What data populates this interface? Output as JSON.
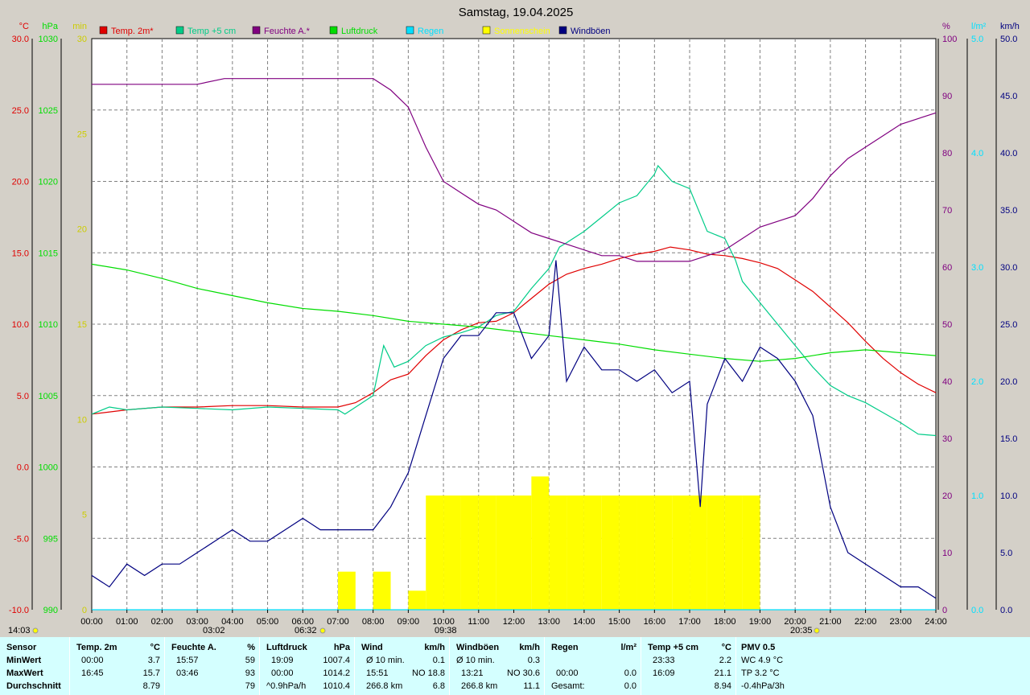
{
  "title": "Samstag, 19.04.2025",
  "colors": {
    "temp2m": "#e00000",
    "temp5cm": "#00cc88",
    "humidity": "#800080",
    "pressure": "#00dd00",
    "rain": "#00e0ff",
    "sun": "#ffff00",
    "gust": "#000080",
    "stats_bg": "#d4ffff",
    "plot_bg": "#ffffff",
    "frame_bg": "#d4d0c8"
  },
  "axis_units": {
    "temp": "°C",
    "pressure": "hPa",
    "sun": "min",
    "humidity": "%",
    "rain": "l/m²",
    "wind": "km/h"
  },
  "legend": [
    {
      "label": "Temp. 2m*",
      "color": "#e00000"
    },
    {
      "label": "Temp +5 cm",
      "color": "#00cc88"
    },
    {
      "label": "Feuchte A.*",
      "color": "#800080"
    },
    {
      "label": "Luftdruck",
      "color": "#00dd00"
    },
    {
      "label": "Regen",
      "color": "#00e0ff"
    },
    {
      "label": "Sonnenschein",
      "color": "#ffff00"
    },
    {
      "label": "Windböen",
      "color": "#000080"
    }
  ],
  "sun_markers": {
    "sunrise": "06:32",
    "sunset": "20:35",
    "day_length": "14:03"
  },
  "time_markers": [
    "03:02",
    "09:38"
  ],
  "chart_data": {
    "type": "line",
    "title": "Samstag, 19.04.2025",
    "x_ticks": [
      "00:00",
      "01:00",
      "02:00",
      "03:00",
      "04:00",
      "05:00",
      "06:00",
      "07:00",
      "08:00",
      "09:00",
      "10:00",
      "11:00",
      "12:00",
      "13:00",
      "14:00",
      "15:00",
      "16:00",
      "17:00",
      "18:00",
      "19:00",
      "20:00",
      "21:00",
      "22:00",
      "23:00",
      "24:00"
    ],
    "axes": {
      "temp": {
        "unit": "°C",
        "ylim": [
          -10,
          30
        ],
        "ticks": [
          "30.0",
          "25.0",
          "20.0",
          "15.0",
          "10.0",
          "5.0",
          "0.0",
          "-5.0",
          "-10.0"
        ]
      },
      "pressure": {
        "unit": "hPa",
        "ylim": [
          990,
          1030
        ],
        "ticks": [
          "1030",
          "1025",
          "1020",
          "1015",
          "1010",
          "1005",
          "1000",
          "995",
          "990"
        ]
      },
      "sun": {
        "unit": "min",
        "ylim": [
          0,
          30
        ],
        "ticks": [
          "30",
          "25",
          "20",
          "15",
          "10",
          "5",
          "0"
        ]
      },
      "humidity": {
        "unit": "%",
        "ylim": [
          0,
          100
        ],
        "ticks": [
          "100",
          "90",
          "80",
          "70",
          "60",
          "50",
          "40",
          "30",
          "20",
          "10",
          "0"
        ]
      },
      "rain": {
        "unit": "l/m²",
        "ylim": [
          0,
          5
        ],
        "ticks": [
          "5.0",
          "4.0",
          "3.0",
          "2.0",
          "1.0",
          "0.0"
        ]
      },
      "wind": {
        "unit": "km/h",
        "ylim": [
          0,
          50
        ],
        "ticks": [
          "50.0",
          "45.0",
          "40.0",
          "35.0",
          "30.0",
          "25.0",
          "20.0",
          "15.0",
          "10.0",
          "5.0",
          "0.0"
        ]
      }
    },
    "grid": true,
    "legend_position": "top",
    "series": [
      {
        "name": "Temp. 2m*",
        "axis": "temp",
        "x": [
          0,
          1,
          2,
          3,
          4,
          5,
          6,
          7,
          7.5,
          8,
          8.5,
          9,
          9.5,
          10,
          10.5,
          11,
          11.5,
          12,
          12.5,
          13,
          13.5,
          14,
          14.5,
          15,
          15.5,
          16,
          16.45,
          17,
          17.5,
          18,
          18.5,
          19,
          19.5,
          20,
          20.5,
          21,
          21.5,
          22,
          22.5,
          23,
          23.5,
          24
        ],
        "y": [
          3.7,
          4.0,
          4.2,
          4.2,
          4.3,
          4.3,
          4.2,
          4.2,
          4.5,
          5.2,
          6.1,
          6.5,
          7.8,
          8.9,
          9.6,
          10.1,
          10.2,
          10.8,
          11.8,
          12.8,
          13.5,
          13.9,
          14.2,
          14.6,
          14.9,
          15.1,
          15.4,
          15.2,
          14.9,
          14.8,
          14.6,
          14.3,
          13.9,
          13.1,
          12.3,
          11.2,
          10.1,
          8.8,
          7.6,
          6.6,
          5.8,
          5.2
        ]
      },
      {
        "name": "Temp +5 cm",
        "axis": "temp",
        "x": [
          0,
          0.5,
          1,
          2,
          3,
          4,
          5,
          6,
          7,
          7.2,
          8,
          8.3,
          8.6,
          9,
          9.5,
          10,
          10.5,
          11,
          11.5,
          12,
          12.5,
          13,
          13.3,
          13.5,
          14,
          14.5,
          15,
          15.5,
          16,
          16.1,
          16.5,
          17,
          17.5,
          18,
          18.3,
          18.5,
          19,
          19.5,
          20,
          20.5,
          21,
          21.5,
          22,
          22.5,
          23,
          23.5,
          24
        ],
        "y": [
          3.7,
          4.2,
          4.0,
          4.2,
          4.1,
          4.0,
          4.2,
          4.1,
          4.0,
          3.7,
          5.0,
          8.5,
          7.0,
          7.4,
          8.5,
          9.1,
          9.4,
          9.8,
          10.6,
          10.9,
          12.5,
          13.9,
          15.4,
          15.7,
          16.5,
          17.5,
          18.5,
          19.0,
          20.5,
          21.1,
          20.0,
          19.5,
          16.5,
          16.0,
          14.5,
          13.0,
          11.5,
          10.0,
          8.5,
          7.0,
          5.7,
          5.0,
          4.5,
          3.8,
          3.1,
          2.3,
          2.2
        ]
      },
      {
        "name": "Feuchte A.*",
        "axis": "humidity",
        "x": [
          0,
          1,
          2,
          3,
          3.77,
          4,
          5,
          6,
          7,
          8,
          8.5,
          9,
          9.5,
          10,
          10.5,
          11,
          11.5,
          12,
          12.5,
          13,
          13.5,
          14,
          14.5,
          15,
          15.5,
          16,
          16.5,
          17,
          17.5,
          18,
          18.5,
          19,
          19.5,
          20,
          20.5,
          21,
          21.5,
          22,
          22.5,
          23,
          23.5,
          24
        ],
        "y": [
          92,
          92,
          92,
          92,
          93,
          93,
          93,
          93,
          93,
          93,
          91,
          88,
          81,
          75,
          73,
          71,
          70,
          68,
          66,
          65,
          64,
          63,
          62,
          62,
          61,
          61,
          61,
          61,
          62,
          63,
          65,
          67,
          68,
          69,
          72,
          76,
          79,
          81,
          83,
          85,
          86,
          87
        ]
      },
      {
        "name": "Luftdruck",
        "axis": "pressure",
        "x": [
          0,
          1,
          2,
          3,
          4,
          5,
          6,
          7,
          8,
          9,
          10,
          11,
          12,
          13,
          14,
          15,
          16,
          17,
          18,
          19,
          20,
          21,
          22,
          23,
          24
        ],
        "y": [
          1014.2,
          1013.8,
          1013.2,
          1012.5,
          1012.0,
          1011.5,
          1011.1,
          1010.9,
          1010.6,
          1010.2,
          1010.0,
          1009.8,
          1009.5,
          1009.2,
          1008.9,
          1008.6,
          1008.2,
          1007.9,
          1007.6,
          1007.4,
          1007.6,
          1008.0,
          1008.2,
          1008.0,
          1007.8
        ]
      },
      {
        "name": "Windböen",
        "axis": "wind",
        "x": [
          0,
          0.5,
          1,
          1.5,
          2,
          2.5,
          3,
          3.5,
          4,
          4.5,
          5,
          5.5,
          6,
          6.5,
          7,
          7.5,
          8,
          8.5,
          9,
          9.5,
          10,
          10.5,
          11,
          11.5,
          12,
          12.5,
          13,
          13.2,
          13.5,
          14,
          14.5,
          15,
          15.5,
          16,
          16.5,
          17,
          17.3,
          17.5,
          18,
          18.5,
          19,
          19.5,
          20,
          20.5,
          21,
          21.5,
          22,
          22.5,
          23,
          23.5,
          24
        ],
        "y": [
          3,
          2,
          4,
          3,
          4,
          4,
          5,
          6,
          7,
          6,
          6,
          7,
          8,
          7,
          7,
          7,
          7,
          9,
          12,
          17,
          22,
          24,
          24,
          26,
          26,
          22,
          24,
          30.6,
          20,
          23,
          21,
          21,
          20,
          21,
          19,
          20,
          9,
          18,
          22,
          20,
          23,
          22,
          20,
          17,
          9,
          5,
          4,
          3,
          2,
          2,
          1
        ]
      },
      {
        "name": "Sonnenschein",
        "axis": "sun",
        "x": [
          6.5,
          7,
          7.5,
          8,
          8.5,
          9,
          9.5,
          10,
          10.5,
          11,
          11.5,
          12,
          12.5,
          13,
          13.5,
          14,
          14.5,
          15,
          15.5,
          16,
          16.5,
          17,
          17.5,
          18,
          18.5,
          19,
          19.5,
          20,
          20.5
        ],
        "y": [
          0,
          2,
          0,
          2,
          0,
          1,
          6,
          6,
          6,
          6,
          6,
          6,
          7,
          6,
          6,
          6,
          6,
          6,
          6,
          6,
          6,
          6,
          6,
          6,
          6,
          0,
          0,
          0,
          0
        ]
      },
      {
        "name": "Regen",
        "axis": "rain",
        "x": [
          0,
          24
        ],
        "y": [
          0,
          0
        ]
      }
    ]
  },
  "stats": {
    "headers": {
      "sensor": "Sensor",
      "temp": {
        "label": "Temp. 2m",
        "unit": "°C"
      },
      "hum": {
        "label": "Feuchte A.",
        "unit": "%"
      },
      "press": {
        "label": "Luftdruck",
        "unit": "hPa"
      },
      "wind": {
        "label": "Wind",
        "unit": "km/h"
      },
      "gust": {
        "label": "Windböen",
        "unit": "km/h"
      },
      "rain": {
        "label": "Regen",
        "unit": "l/m²"
      },
      "t5": {
        "label": "Temp +5 cm",
        "unit": "°C"
      },
      "pmv": {
        "label": "PMV 0.5"
      }
    },
    "row_labels": [
      "MinWert",
      "MaxWert",
      "Durchschnitt"
    ],
    "temp": {
      "min_time": "00:00",
      "min_val": "3.7",
      "max_time": "16:45",
      "max_val": "15.7",
      "avg": "8.79"
    },
    "hum": {
      "min_time": "15:57",
      "min_val": "59",
      "max_time": "03:46",
      "max_val": "93",
      "avg": "79"
    },
    "press": {
      "min_time": "19:09",
      "min_val": "1007.4",
      "max_time": "00:00",
      "max_val": "1014.2",
      "trend": "^0.9hPa/h",
      "avg": "1010.4"
    },
    "wind": {
      "r1_label": "Ø 10 min.",
      "r1_val": "0.1",
      "r2_time": "15:51",
      "r2_val": "NO 18.8",
      "r3_label": "266.8 km",
      "r3_val": "6.8"
    },
    "gust": {
      "r1_label": "Ø 10 min.",
      "r1_val": "0.3",
      "r2_time": "13:21",
      "r2_val": "NO 30.6",
      "r3_label": "266.8 km",
      "r3_val": "11.1"
    },
    "rain": {
      "r2_time": "00:00",
      "r2_val": "0.0",
      "r3_label": "Gesamt:",
      "r3_val": "0.0"
    },
    "t5": {
      "min_time": "23:33",
      "min_val": "2.2",
      "max_time": "16:09",
      "max_val": "21.1",
      "avg": "8.94"
    },
    "pmv": {
      "r1": "WC 4.9 °C",
      "r2": "TP 3.2 °C",
      "r3": "-0.4hPa/3h"
    }
  }
}
